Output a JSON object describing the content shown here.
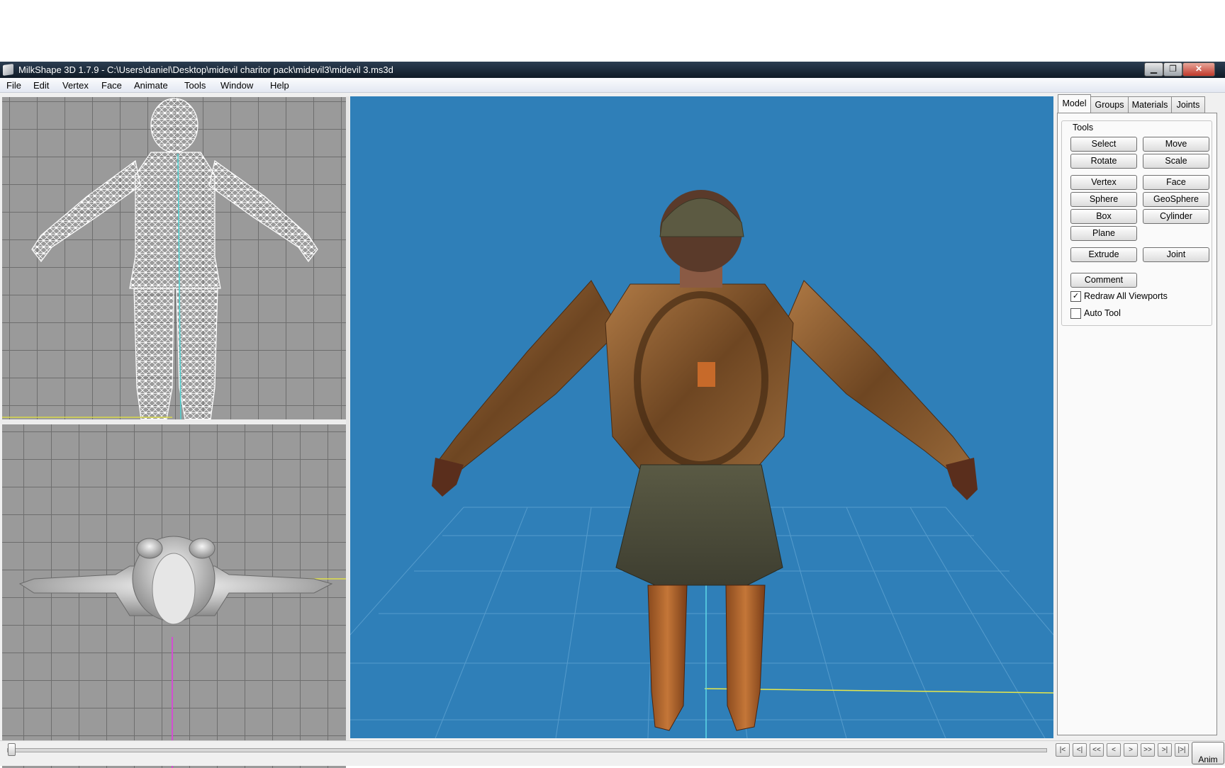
{
  "window": {
    "title": "MilkShape 3D 1.7.9 - C:\\Users\\daniel\\Desktop\\midevil charitor pack\\midevil3\\midevil 3.ms3d",
    "controls": {
      "minimize": "▁",
      "maximize": "❐",
      "close": "✕"
    }
  },
  "menu": [
    "File",
    "Edit",
    "Vertex",
    "Face",
    "Animate",
    "Tools",
    "Window",
    "Help"
  ],
  "viewports": {
    "front": {
      "mode": "wireframe"
    },
    "top": {
      "mode": "flat shaded"
    },
    "perspective": {
      "mode": "textured",
      "background_color": "#2f7fb8"
    }
  },
  "panel": {
    "tabs": [
      "Model",
      "Groups",
      "Materials",
      "Joints"
    ],
    "active_tab": "Model",
    "group_label": "Tools",
    "buttons": {
      "select": "Select",
      "move": "Move",
      "rotate": "Rotate",
      "scale": "Scale",
      "vertex": "Vertex",
      "face": "Face",
      "sphere": "Sphere",
      "geosphere": "GeoSphere",
      "box": "Box",
      "cylinder": "Cylinder",
      "plane": "Plane",
      "extrude": "Extrude",
      "joint": "Joint",
      "comment": "Comment"
    },
    "checkboxes": {
      "redraw_all_viewports": {
        "label": "Redraw All Viewports",
        "checked": true
      },
      "auto_tool": {
        "label": "Auto Tool",
        "checked": false
      }
    }
  },
  "timeline": {
    "nav_buttons": [
      "|<",
      "<|",
      "<<",
      "<",
      ">",
      ">>",
      ">|",
      "|>|"
    ],
    "anim_label": "Anim"
  },
  "colors": {
    "accent_titlebar": "#1b2a3a",
    "viewport_grid": "#9a9a9a",
    "perspective_bg": "#2f7fb8"
  }
}
